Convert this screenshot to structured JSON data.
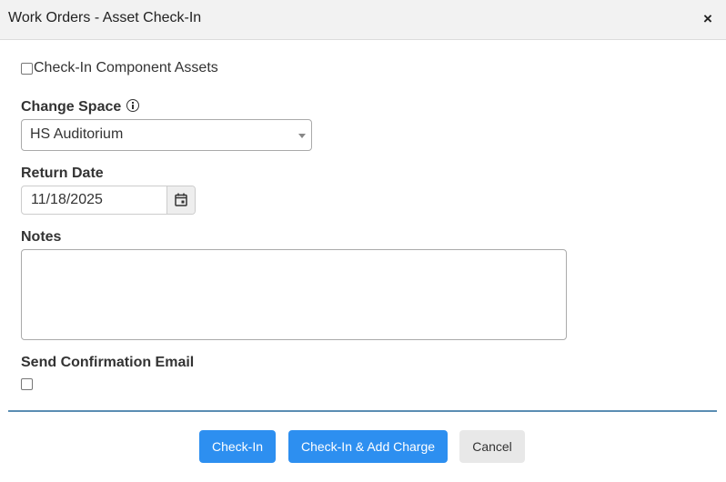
{
  "dialog": {
    "title": "Work Orders - Asset Check-In",
    "close_glyph": "×"
  },
  "component_assets": {
    "label": "Check-In Component Assets",
    "checked": false
  },
  "change_space": {
    "label": "Change Space",
    "info_icon": "info-circle-icon",
    "selected_value": "HS Auditorium"
  },
  "return_date": {
    "label": "Return Date",
    "value": "11/18/2025",
    "icon": "calendar-icon"
  },
  "notes": {
    "label": "Notes",
    "value": ""
  },
  "confirmation_email": {
    "label": "Send Confirmation Email",
    "checked": false
  },
  "footer": {
    "checkin_label": "Check-In",
    "checkin_add_charge_label": "Check-In & Add Charge",
    "cancel_label": "Cancel"
  },
  "colors": {
    "primary": "#2d8ff0",
    "divider": "#5a8db3",
    "titlebar_bg": "#f2f2f2",
    "cancel_bg": "#e8e8e8"
  }
}
